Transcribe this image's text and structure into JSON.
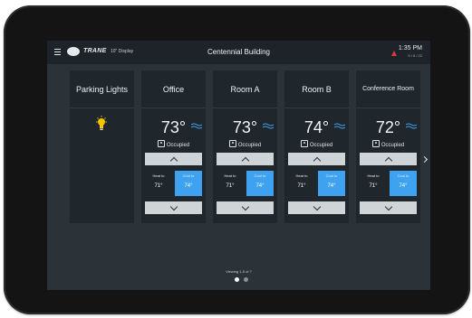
{
  "header": {
    "brand": "TRANE",
    "device": "10\" Display",
    "building": "Centennial Building",
    "time": "1:35 PM",
    "date": "9 / 8 / 22"
  },
  "tiles": [
    {
      "title": "Parking Lights",
      "type": "light"
    },
    {
      "title": "Office",
      "temp": "73°",
      "status": "Occupied",
      "heat_label": "Heat to",
      "heat_value": "71°",
      "cool_label": "Cool to",
      "cool_value": "74°"
    },
    {
      "title": "Room A",
      "temp": "73°",
      "status": "Occupied",
      "heat_label": "Heat to",
      "heat_value": "71°",
      "cool_label": "Cool to",
      "cool_value": "74°"
    },
    {
      "title": "Room B",
      "temp": "74°",
      "status": "Occupied",
      "heat_label": "Heat to",
      "heat_value": "71°",
      "cool_label": "Cool to",
      "cool_value": "74°"
    },
    {
      "title": "Conference Room",
      "temp": "72°",
      "status": "Occupied",
      "heat_label": "Heat to",
      "heat_value": "71°",
      "cool_label": "Cool to",
      "cool_value": "74°"
    }
  ],
  "pager": {
    "text": "Viewing 1-5 of 7",
    "pages": 2,
    "current": 1
  },
  "colors": {
    "accent": "#3fa2f0",
    "alert": "#e0393b",
    "bulb": "#f6c500",
    "fan": "#3fa2f0"
  }
}
